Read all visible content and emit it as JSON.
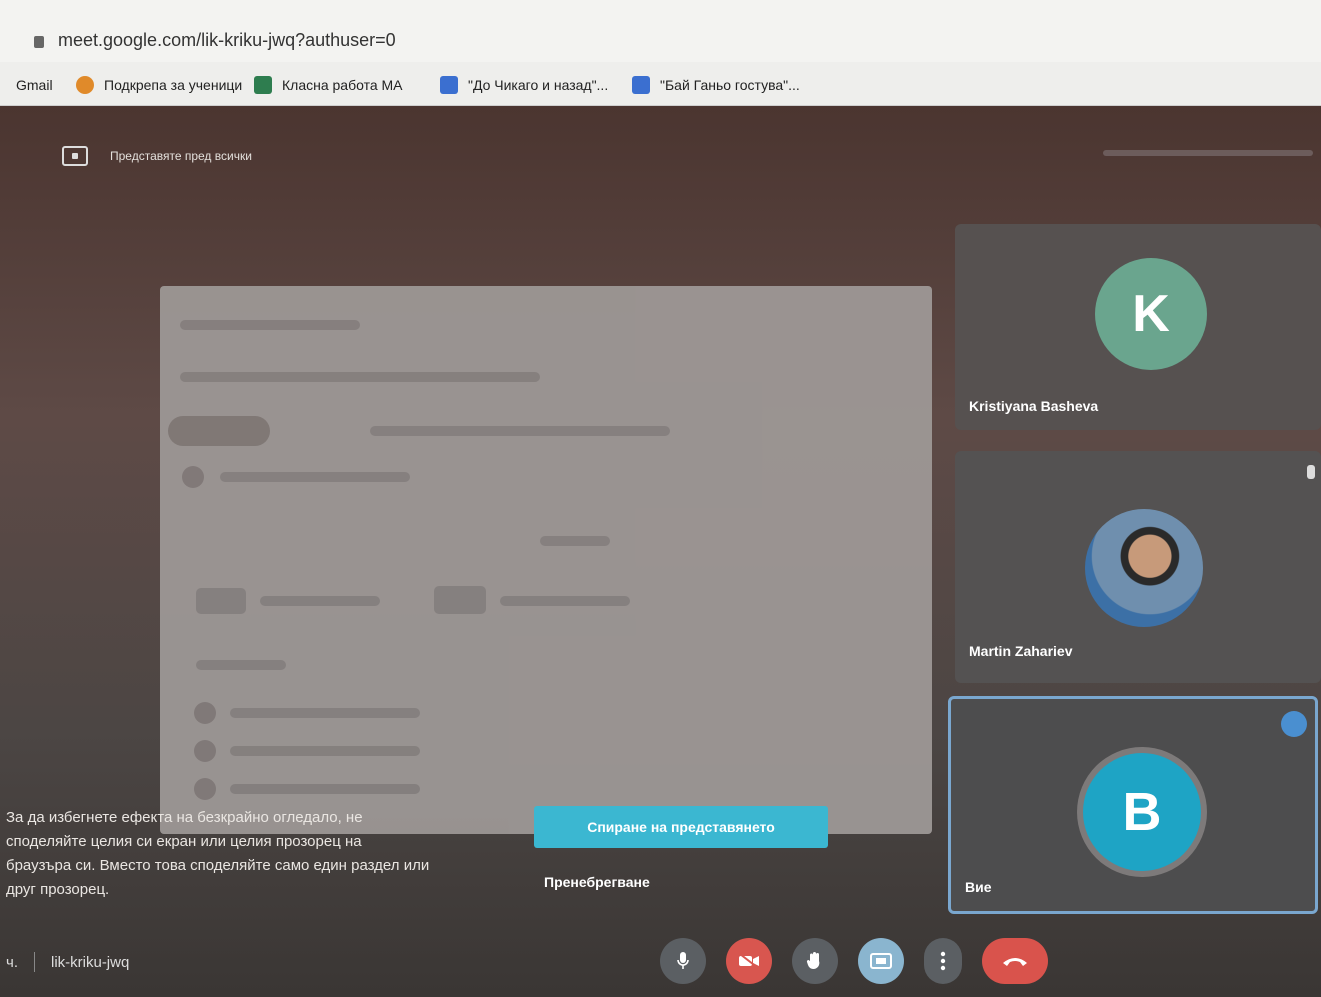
{
  "browser": {
    "url": "meet.google.com/lik-kriku-jwq?authuser=0",
    "bookmarks": [
      {
        "label": "Gmail",
        "icon": "gmail-icon",
        "color": "#c94a3f"
      },
      {
        "label": "Подкрепа за ученици",
        "icon": "orange-dot-icon",
        "color": "#e08a2a"
      },
      {
        "label": "Класна работа МА",
        "icon": "classroom-icon",
        "color": "#2e7d4f"
      },
      {
        "label": "\"До Чикаго и назад\"...",
        "icon": "doc-icon",
        "color": "#3b6fd0"
      },
      {
        "label": "\"Бай Ганьо гостува\"...",
        "icon": "doc-icon",
        "color": "#3b6fd0"
      }
    ]
  },
  "meet": {
    "presenting_banner": "Представяте пред всички",
    "notice_lines": [
      "За да избегнете ефекта на безкрайно огледало, не",
      "споделяйте целия си екран или целия прозорец на",
      "браузъра си. Вместо това споделяйте само един раздел или",
      "друг прозорец."
    ],
    "stop_presenting": "Спиране на представянето",
    "dismiss": "Пренебрегване",
    "meeting_code": "lik-kriku-jwq",
    "participants": [
      {
        "name": "Kristiyana Basheva",
        "initial": "K",
        "color": "#6aa58e"
      },
      {
        "name": "Martin Zahariev",
        "initial": "",
        "color": ""
      },
      {
        "name": "Вие",
        "initial": "B",
        "color": "#1ea4c5"
      }
    ]
  }
}
